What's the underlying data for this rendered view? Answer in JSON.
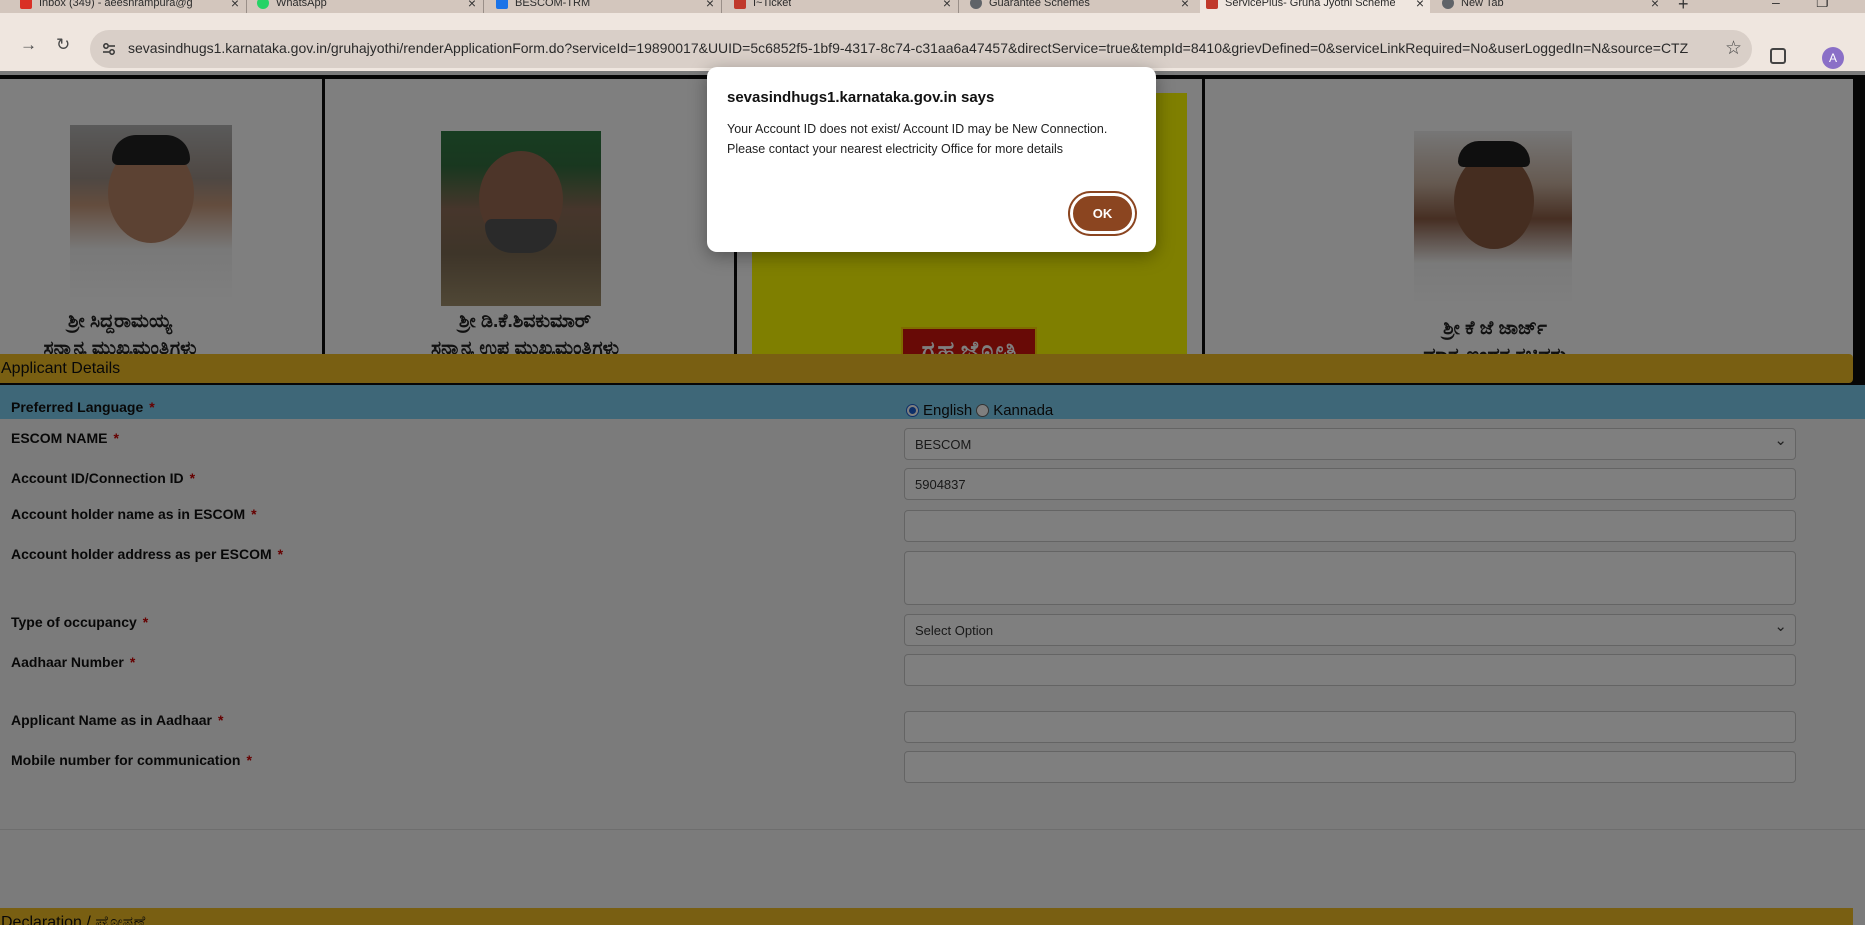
{
  "browser": {
    "tabs": [
      {
        "label": "Inbox (349) - aeesnrampura@g",
        "icon": "gmail-icon",
        "color": "#d93025"
      },
      {
        "label": "WhatsApp",
        "icon": "whatsapp-icon",
        "color": "#25d366"
      },
      {
        "label": "BESCOM-TRM",
        "icon": "bescom-icon",
        "color": "#1a73e8"
      },
      {
        "label": "I~Ticket",
        "icon": "ticket-icon",
        "color": "#c0392b"
      },
      {
        "label": "Guarantee Schemes",
        "icon": "globe-icon",
        "color": "#5f6368"
      },
      {
        "label": "ServicePlus- Gruha Jyothi Scheme",
        "icon": "serviceplus-icon",
        "color": "#c0392b"
      },
      {
        "label": "New Tab",
        "icon": "globe-icon",
        "color": "#5f6368"
      }
    ],
    "url": "sevasindhugs1.karnataka.gov.in/gruhajyothi/renderApplicationForm.do?serviceId=19890017&UUID=5c6852f5-1bf9-4317-8c74-c31aa6a47457&directService=true&tempId=8410&grievDefined=0&serviceLinkRequired=No&userLoggedIn=N&source=CTZ...",
    "profile_initial": "A"
  },
  "banner": {
    "left_caption_1": "ಶ್ರೀ ಸಿದ್ದರಾಮಯ್ಯ",
    "left_caption_2": "ಸನ್ಮಾನ್ಯ ಮುಖ್ಯಮಂತ್ರಿಗಳು",
    "mid_caption_1": "ಶ್ರೀ ಡಿ.ಕೆ.ಶಿವಕುಮಾರ್",
    "mid_caption_2": "ಸನ್ಮಾನ್ಯ ಉಪ ಮುಖ್ಯಮಂತ್ರಿಗಳು",
    "logo_text": "ಗೃಹ ಜ್ಯೋತಿ",
    "right_caption_1": "ಶ್ರೀ ಕೆ ಜೆ ಜಾರ್ಜ್",
    "right_caption_2": "ಮಾನ್ಯ ಇಂಧನ ಸಚಿವರು"
  },
  "form": {
    "section_title": "Applicant Details",
    "preferred_language_label": "Preferred Language",
    "lang_english": "English",
    "lang_kannada": "Kannada",
    "escom_label": "ESCOM NAME",
    "escom_value": "BESCOM",
    "account_id_label": "Account ID/Connection ID",
    "account_id_value": "5904837",
    "holder_name_label": "Account holder name as in ESCOM",
    "holder_address_label": "Account holder address as per ESCOM",
    "occupancy_label": "Type of occupancy",
    "occupancy_value": "Select Option",
    "aadhaar_label": "Aadhaar Number",
    "applicant_name_label": "Applicant Name as in Aadhaar",
    "mobile_label": "Mobile number for communication",
    "required_mark": "*",
    "declaration_title": "Declaration / ಘೋಷಣೆ"
  },
  "dialog": {
    "title": "sevasindhugs1.karnataka.gov.in says",
    "message_line1": "Your Account ID does not exist/ Account ID may be New Connection.",
    "message_line2": "Please contact your nearest electricity Office for more details",
    "ok_label": "OK"
  }
}
